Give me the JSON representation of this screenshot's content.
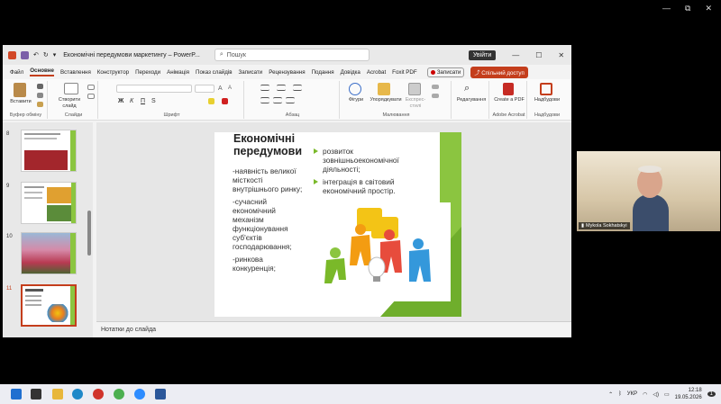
{
  "window": {
    "document_title": "Економічні передумови маркетингу  –  PowerP...",
    "search_placeholder": "Пошук",
    "signin_label": "Увійти",
    "minimize": "—",
    "maximize": "☐",
    "close": "✕"
  },
  "tabs": [
    {
      "label": "Файл"
    },
    {
      "label": "Основне",
      "active": true
    },
    {
      "label": "Вставлення"
    },
    {
      "label": "Конструктор"
    },
    {
      "label": "Переходи"
    },
    {
      "label": "Анімація"
    },
    {
      "label": "Показ слайдів"
    },
    {
      "label": "Записати"
    },
    {
      "label": "Рецензування"
    },
    {
      "label": "Подання"
    },
    {
      "label": "Довідка"
    },
    {
      "label": "Acrobat"
    },
    {
      "label": "Foxit PDF"
    }
  ],
  "record_label": "Записати",
  "share_label": "Спільний доступ",
  "ribbon": {
    "paste_label": "Вставити",
    "clipboard_group": "Буфер обміну",
    "new_slide_label": "Створити слайд",
    "slides_group": "Слайди",
    "font_group": "Шрифт",
    "paragraph_group": "Абзац",
    "shapes_label": "Фігури",
    "arrange_label": "Упорядкувати",
    "quick_styles_label": "Експрес-стилі",
    "drawing_group": "Малювання",
    "editing_label": "Редагування",
    "create_pdf_label": "Create a PDF",
    "acrobat_group": "Adobe Acrobat",
    "addins_label": "Надбудови",
    "addins_group": "Надбудови"
  },
  "thumbnails": [
    {
      "number": "8"
    },
    {
      "number": "9"
    },
    {
      "number": "10"
    },
    {
      "number": "11",
      "selected": true
    }
  ],
  "slide": {
    "title_line1": "Економічні",
    "title_line2": "передумови",
    "left_items": [
      "-наявність великої місткості внутрішнього ринку;",
      "-сучасний економічний механізм функціонування суб'єктів господарювання;",
      "-ринкова конкуренція;"
    ],
    "right_items": [
      "розвиток зовнішньоекономічної діяльності;",
      "інтеграція в світовий економічний простір."
    ]
  },
  "notes_placeholder": "Нотатки до слайда",
  "video": {
    "participant_name": "Mykola Sokhatskyi"
  },
  "taskbar": {
    "language": "УКР",
    "time": "12:18",
    "date": "19.05.2026",
    "notification_count": "1"
  }
}
